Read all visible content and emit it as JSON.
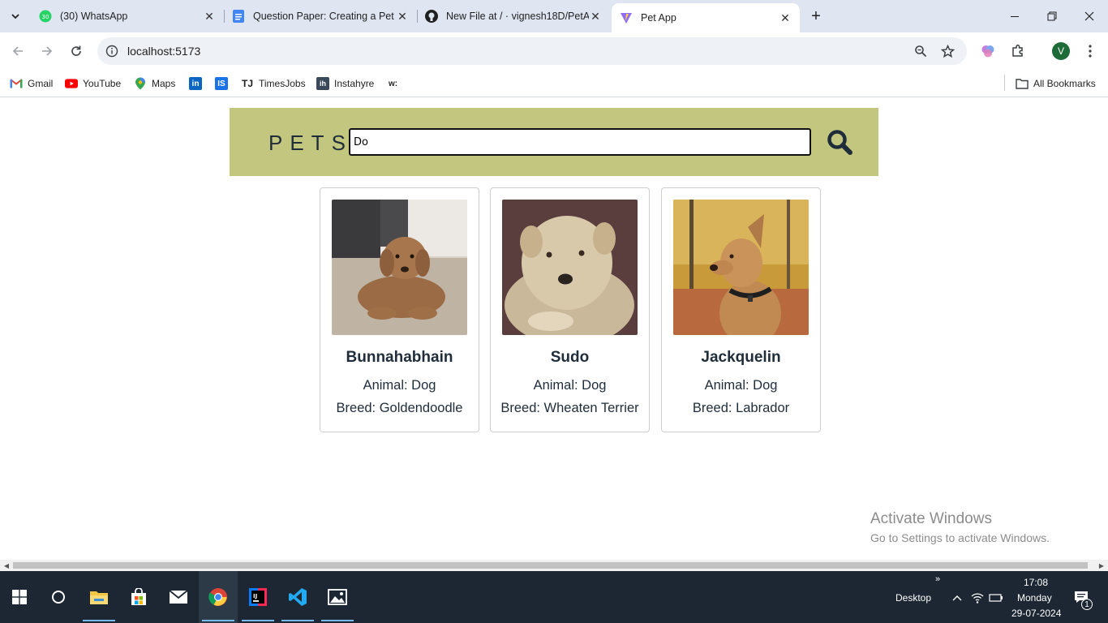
{
  "browser": {
    "tabs": [
      {
        "title": "(30) WhatsApp",
        "badge": "30",
        "active": false
      },
      {
        "title": "Question Paper: Creating a Pet",
        "active": false
      },
      {
        "title": "New File at / · vignesh18D/PetA",
        "active": false
      },
      {
        "title": "Pet App",
        "active": true
      }
    ],
    "url": "localhost:5173",
    "profile_initial": "V",
    "bookmarks": [
      {
        "label": "Gmail",
        "icon": "gmail-icon"
      },
      {
        "label": "YouTube",
        "icon": "youtube-icon"
      },
      {
        "label": "Maps",
        "icon": "maps-icon"
      },
      {
        "label": "",
        "icon": "linkedin-icon"
      },
      {
        "label": "",
        "icon": "iimjobs-icon"
      },
      {
        "label": "TimesJobs",
        "icon": "timesjobs-icon"
      },
      {
        "label": "Instahyre",
        "icon": "instahyre-icon"
      },
      {
        "label": "w:",
        "icon": "w-icon"
      }
    ],
    "all_bookmarks": "All Bookmarks"
  },
  "app": {
    "brand": "PETS",
    "search_value": "Do",
    "pets": [
      {
        "name": "Bunnahabhain",
        "animal": "Animal: Dog",
        "breed": "Breed: Goldendoodle"
      },
      {
        "name": "Sudo",
        "animal": "Animal: Dog",
        "breed": "Breed: Wheaten Terrier"
      },
      {
        "name": "Jackquelin",
        "animal": "Animal: Dog",
        "breed": "Breed: Labrador"
      }
    ]
  },
  "watermark": {
    "line1": "Activate Windows",
    "line2": "Go to Settings to activate Windows."
  },
  "taskbar": {
    "desktop_label": "Desktop",
    "time": "17:08",
    "day": "Monday",
    "date": "29-07-2024",
    "notification_count": "1"
  },
  "colors": {
    "header_band": "#c3c67e",
    "text_dark": "#1f2d3a",
    "taskbar": "#1c2733"
  }
}
